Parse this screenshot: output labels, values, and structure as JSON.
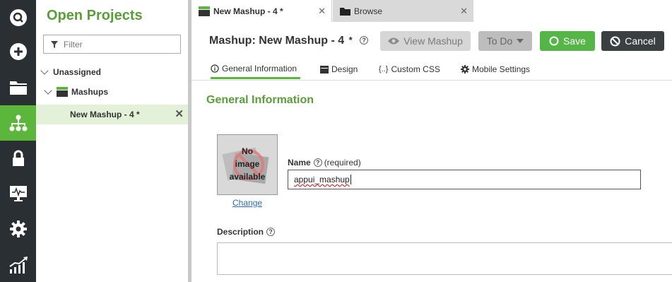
{
  "sidebar_icons": [
    {
      "name": "search-icon",
      "active": false
    },
    {
      "name": "add-icon",
      "active": false
    },
    {
      "name": "folder-icon",
      "active": false
    },
    {
      "name": "hierarchy-icon",
      "active": true
    },
    {
      "name": "lock-icon",
      "active": false
    },
    {
      "name": "monitor-icon",
      "active": false
    },
    {
      "name": "gear-icon",
      "active": false
    },
    {
      "name": "analytics-icon",
      "active": false
    }
  ],
  "projects": {
    "title": "Open Projects",
    "filter_placeholder": "Filter",
    "tree": {
      "group": "Unassigned",
      "folder": "Mashups",
      "item": "New Mashup - 4 *"
    }
  },
  "tabs": [
    {
      "label": "New Mashup - 4 *",
      "active": true
    },
    {
      "label": "Browse",
      "active": false
    }
  ],
  "header": {
    "title": "Mashup: New Mashup - 4",
    "dirty_mark": "*",
    "help_icon": "?",
    "view_mashup": "View Mashup",
    "todo": "To Do",
    "save": "Save",
    "cancel": "Cancel"
  },
  "subtabs": [
    {
      "label": "General Information",
      "icon": "info-icon",
      "active": true
    },
    {
      "label": "Design",
      "icon": "design-icon",
      "active": false
    },
    {
      "label": "Custom CSS",
      "icon": "css-icon",
      "active": false
    },
    {
      "label": "Mobile Settings",
      "icon": "gear-icon",
      "active": false
    }
  ],
  "general": {
    "section_title": "General Information",
    "no_image_line1": "No",
    "no_image_line2": "image",
    "no_image_line3": "available",
    "change_link": "Change",
    "name_label": "Name",
    "name_required": "(required)",
    "name_value": "appui_mashup",
    "description_label": "Description"
  },
  "colors": {
    "accent_green": "#5bb73b",
    "title_green": "#5a9e3a",
    "sidebar_dark": "#2a2f33",
    "cancel_dark": "#3a3f42"
  }
}
